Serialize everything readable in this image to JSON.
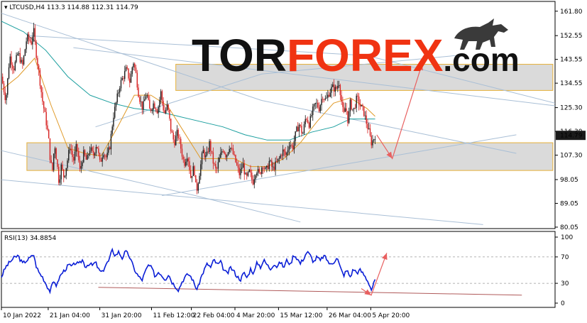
{
  "chart_data": [
    {
      "type": "candlestick",
      "symbol": "LTCUSD",
      "timeframe": "H4",
      "ohlc": {
        "open": 113.3,
        "high": 114.88,
        "low": 112.31,
        "close": 114.79
      },
      "current_price_label": "114.79",
      "price_tick_labels": [
        "161.80",
        "152.55",
        "143.55",
        "134.55",
        "125.30",
        "116.30",
        "107.30",
        "98.05",
        "89.05",
        "80.05"
      ],
      "price_ticks": [
        161.8,
        152.55,
        143.55,
        134.55,
        125.3,
        116.3,
        107.3,
        98.05,
        89.05,
        80.05
      ],
      "ylim": [
        79.5,
        165.5
      ],
      "time_tick_labels": [
        "10 Jan 2022",
        "21 Jan 04:00",
        "31 Jan 20:00",
        "11 Feb 12:00",
        "22 Feb 04:00",
        "4 Mar 20:00",
        "15 Mar 12:00",
        "26 Mar 04:00",
        "5 Apr 20:00"
      ],
      "time_ticks_x": [
        0,
        0.0845,
        0.1777,
        0.2711,
        0.3431,
        0.4218,
        0.5005,
        0.5883,
        0.6671
      ],
      "close_path": [
        [
          0.0,
          137
        ],
        [
          0.008,
          128
        ],
        [
          0.015,
          145
        ],
        [
          0.022,
          140
        ],
        [
          0.03,
          146
        ],
        [
          0.038,
          141
        ],
        [
          0.046,
          152
        ],
        [
          0.054,
          150
        ],
        [
          0.058,
          155
        ],
        [
          0.062,
          147
        ],
        [
          0.068,
          138
        ],
        [
          0.074,
          128
        ],
        [
          0.08,
          121
        ],
        [
          0.085,
          114
        ],
        [
          0.088,
          106
        ],
        [
          0.092,
          101
        ],
        [
          0.096,
          112
        ],
        [
          0.1,
          105
        ],
        [
          0.104,
          97
        ],
        [
          0.108,
          103
        ],
        [
          0.113,
          99
        ],
        [
          0.118,
          104
        ],
        [
          0.124,
          111
        ],
        [
          0.13,
          105
        ],
        [
          0.136,
          111
        ],
        [
          0.142,
          101
        ],
        [
          0.148,
          108
        ],
        [
          0.154,
          105
        ],
        [
          0.16,
          110
        ],
        [
          0.166,
          107
        ],
        [
          0.172,
          112
        ],
        [
          0.178,
          104
        ],
        [
          0.184,
          109
        ],
        [
          0.19,
          106
        ],
        [
          0.196,
          111
        ],
        [
          0.202,
          122
        ],
        [
          0.208,
          128
        ],
        [
          0.214,
          134
        ],
        [
          0.22,
          137
        ],
        [
          0.226,
          140
        ],
        [
          0.232,
          135
        ],
        [
          0.238,
          143
        ],
        [
          0.243,
          138
        ],
        [
          0.248,
          130
        ],
        [
          0.255,
          125
        ],
        [
          0.262,
          131
        ],
        [
          0.268,
          124
        ],
        [
          0.275,
          127
        ],
        [
          0.282,
          124
        ],
        [
          0.288,
          131
        ],
        [
          0.294,
          123
        ],
        [
          0.3,
          126
        ],
        [
          0.306,
          117
        ],
        [
          0.312,
          112
        ],
        [
          0.318,
          116
        ],
        [
          0.324,
          110
        ],
        [
          0.33,
          104
        ],
        [
          0.336,
          108
        ],
        [
          0.342,
          99
        ],
        [
          0.348,
          103
        ],
        [
          0.352,
          93
        ],
        [
          0.358,
          101
        ],
        [
          0.364,
          109
        ],
        [
          0.37,
          106
        ],
        [
          0.376,
          112
        ],
        [
          0.382,
          105
        ],
        [
          0.388,
          101
        ],
        [
          0.394,
          106
        ],
        [
          0.4,
          110
        ],
        [
          0.406,
          107
        ],
        [
          0.412,
          111
        ],
        [
          0.418,
          108
        ],
        [
          0.424,
          104
        ],
        [
          0.43,
          100
        ],
        [
          0.436,
          104
        ],
        [
          0.442,
          98
        ],
        [
          0.448,
          101
        ],
        [
          0.454,
          97
        ],
        [
          0.46,
          102
        ],
        [
          0.466,
          100
        ],
        [
          0.472,
          104
        ],
        [
          0.478,
          101
        ],
        [
          0.484,
          105
        ],
        [
          0.49,
          102
        ],
        [
          0.496,
          104
        ],
        [
          0.502,
          106
        ],
        [
          0.508,
          109
        ],
        [
          0.514,
          107
        ],
        [
          0.52,
          112
        ],
        [
          0.526,
          110
        ],
        [
          0.532,
          116
        ],
        [
          0.538,
          119
        ],
        [
          0.544,
          115
        ],
        [
          0.55,
          122
        ],
        [
          0.556,
          119
        ],
        [
          0.562,
          124
        ],
        [
          0.568,
          127
        ],
        [
          0.574,
          125
        ],
        [
          0.58,
          130
        ],
        [
          0.586,
          128
        ],
        [
          0.592,
          131
        ],
        [
          0.598,
          133
        ],
        [
          0.604,
          132
        ],
        [
          0.61,
          135
        ],
        [
          0.614,
          128
        ],
        [
          0.618,
          122
        ],
        [
          0.622,
          126
        ],
        [
          0.626,
          120
        ],
        [
          0.63,
          127
        ],
        [
          0.636,
          124
        ],
        [
          0.642,
          129
        ],
        [
          0.648,
          126
        ],
        [
          0.654,
          124
        ],
        [
          0.66,
          119
        ],
        [
          0.664,
          116
        ],
        [
          0.668,
          112
        ],
        [
          0.672,
          113.3
        ],
        [
          0.675,
          114.79
        ]
      ],
      "ma_fast": [
        [
          0.0,
          132
        ],
        [
          0.03,
          137
        ],
        [
          0.06,
          144
        ],
        [
          0.09,
          126
        ],
        [
          0.12,
          110
        ],
        [
          0.15,
          108
        ],
        [
          0.18,
          107
        ],
        [
          0.21,
          118
        ],
        [
          0.24,
          130
        ],
        [
          0.27,
          130
        ],
        [
          0.3,
          126
        ],
        [
          0.33,
          116
        ],
        [
          0.36,
          106
        ],
        [
          0.39,
          106
        ],
        [
          0.42,
          106
        ],
        [
          0.45,
          103
        ],
        [
          0.48,
          103
        ],
        [
          0.51,
          106
        ],
        [
          0.54,
          112
        ],
        [
          0.57,
          120
        ],
        [
          0.6,
          127
        ],
        [
          0.63,
          129
        ],
        [
          0.66,
          125
        ],
        [
          0.675,
          122
        ]
      ],
      "ma_slow": [
        [
          0.0,
          158
        ],
        [
          0.04,
          154
        ],
        [
          0.08,
          147
        ],
        [
          0.12,
          137
        ],
        [
          0.16,
          130
        ],
        [
          0.2,
          127
        ],
        [
          0.24,
          125
        ],
        [
          0.28,
          124
        ],
        [
          0.32,
          122
        ],
        [
          0.36,
          120
        ],
        [
          0.4,
          118
        ],
        [
          0.44,
          115
        ],
        [
          0.48,
          113
        ],
        [
          0.52,
          113
        ],
        [
          0.56,
          116
        ],
        [
          0.6,
          118
        ],
        [
          0.63,
          121
        ],
        [
          0.66,
          121
        ],
        [
          0.675,
          121
        ]
      ],
      "trendlines": [
        [
          [
            0.0,
            161
          ],
          [
            0.47,
            128
          ],
          [
            0.93,
            108
          ]
        ],
        [
          [
            0.05,
            152.5
          ],
          [
            0.66,
            145
          ],
          [
            1.0,
            127
          ]
        ],
        [
          [
            0.13,
            148
          ],
          [
            1.0,
            126
          ]
        ],
        [
          [
            0.17,
            118
          ],
          [
            0.47,
            138
          ],
          [
            0.82,
            145
          ]
        ],
        [
          [
            0.0,
            109
          ],
          [
            0.35,
            92
          ],
          [
            0.54,
            82
          ]
        ],
        [
          [
            0.0,
            98
          ],
          [
            0.87,
            81
          ]
        ],
        [
          [
            0.29,
            92
          ],
          [
            0.93,
            115
          ]
        ]
      ],
      "zones": [
        {
          "x0": 0.315,
          "x1": 0.996,
          "y0": 131.8,
          "y1": 141.7
        },
        {
          "x0": 0.046,
          "x1": 0.996,
          "y0": 101.5,
          "y1": 112.0
        }
      ],
      "forecast_arrow": [
        [
          0.678,
          115
        ],
        [
          0.706,
          106
        ],
        [
          0.76,
          142
        ]
      ],
      "colors": {
        "bull": "#1a1a1a",
        "bear": "#d62020",
        "ma_fast": "#e09a28",
        "ma_slow": "#1a9e9e",
        "trend": "#a9bfd6",
        "zone_fill": "#d4d4d4",
        "zone_edge": "#e6b038",
        "arrow": "#e86060",
        "price_label_bg": "#1a1a1a",
        "price_label_fg": "#ffffff"
      },
      "logo": {
        "part1": "TOR",
        "part2": "FOREX",
        "part3": ".com",
        "color1": "#111111",
        "color2": "#f03312",
        "color3": "#111111"
      }
    },
    {
      "type": "line",
      "indicator_label": "RSI(13) 34.8854",
      "tick_labels": [
        "100",
        "70",
        "30",
        "0"
      ],
      "ticks": [
        100,
        70,
        30,
        0
      ],
      "ylim": [
        0,
        100
      ],
      "levels": [
        70,
        30
      ],
      "rsi_path": [
        [
          0.0,
          40
        ],
        [
          0.008,
          55
        ],
        [
          0.015,
          62
        ],
        [
          0.022,
          68
        ],
        [
          0.03,
          72
        ],
        [
          0.038,
          60
        ],
        [
          0.046,
          65
        ],
        [
          0.054,
          70
        ],
        [
          0.058,
          75
        ],
        [
          0.062,
          58
        ],
        [
          0.068,
          46
        ],
        [
          0.074,
          40
        ],
        [
          0.08,
          30
        ],
        [
          0.085,
          22
        ],
        [
          0.088,
          18
        ],
        [
          0.092,
          28
        ],
        [
          0.096,
          34
        ],
        [
          0.1,
          25
        ],
        [
          0.104,
          38
        ],
        [
          0.11,
          46
        ],
        [
          0.116,
          52
        ],
        [
          0.122,
          58
        ],
        [
          0.128,
          55
        ],
        [
          0.134,
          62
        ],
        [
          0.14,
          58
        ],
        [
          0.146,
          66
        ],
        [
          0.152,
          55
        ],
        [
          0.158,
          60
        ],
        [
          0.164,
          57
        ],
        [
          0.17,
          62
        ],
        [
          0.176,
          50
        ],
        [
          0.182,
          46
        ],
        [
          0.188,
          58
        ],
        [
          0.194,
          64
        ],
        [
          0.2,
          80
        ],
        [
          0.206,
          72
        ],
        [
          0.212,
          78
        ],
        [
          0.218,
          68
        ],
        [
          0.224,
          78
        ],
        [
          0.23,
          73
        ],
        [
          0.236,
          60
        ],
        [
          0.242,
          48
        ],
        [
          0.248,
          40
        ],
        [
          0.254,
          35
        ],
        [
          0.26,
          48
        ],
        [
          0.266,
          58
        ],
        [
          0.272,
          52
        ],
        [
          0.278,
          40
        ],
        [
          0.284,
          48
        ],
        [
          0.29,
          42
        ],
        [
          0.296,
          36
        ],
        [
          0.302,
          44
        ],
        [
          0.308,
          32
        ],
        [
          0.314,
          26
        ],
        [
          0.32,
          20
        ],
        [
          0.326,
          32
        ],
        [
          0.332,
          40
        ],
        [
          0.338,
          44
        ],
        [
          0.344,
          38
        ],
        [
          0.35,
          26
        ],
        [
          0.354,
          20
        ],
        [
          0.36,
          38
        ],
        [
          0.366,
          50
        ],
        [
          0.372,
          60
        ],
        [
          0.378,
          54
        ],
        [
          0.384,
          66
        ],
        [
          0.39,
          58
        ],
        [
          0.396,
          62
        ],
        [
          0.402,
          50
        ],
        [
          0.408,
          44
        ],
        [
          0.414,
          54
        ],
        [
          0.42,
          48
        ],
        [
          0.426,
          40
        ],
        [
          0.432,
          36
        ],
        [
          0.438,
          46
        ],
        [
          0.444,
          38
        ],
        [
          0.45,
          52
        ],
        [
          0.456,
          45
        ],
        [
          0.462,
          62
        ],
        [
          0.468,
          55
        ],
        [
          0.474,
          65
        ],
        [
          0.48,
          58
        ],
        [
          0.486,
          52
        ],
        [
          0.492,
          60
        ],
        [
          0.498,
          55
        ],
        [
          0.504,
          62
        ],
        [
          0.51,
          54
        ],
        [
          0.516,
          66
        ],
        [
          0.522,
          58
        ],
        [
          0.528,
          74
        ],
        [
          0.534,
          68
        ],
        [
          0.54,
          60
        ],
        [
          0.546,
          68
        ],
        [
          0.552,
          78
        ],
        [
          0.558,
          72
        ],
        [
          0.564,
          62
        ],
        [
          0.57,
          70
        ],
        [
          0.576,
          64
        ],
        [
          0.582,
          72
        ],
        [
          0.588,
          66
        ],
        [
          0.594,
          58
        ],
        [
          0.6,
          62
        ],
        [
          0.606,
          70
        ],
        [
          0.612,
          54
        ],
        [
          0.618,
          42
        ],
        [
          0.624,
          50
        ],
        [
          0.63,
          40
        ],
        [
          0.636,
          52
        ],
        [
          0.642,
          46
        ],
        [
          0.648,
          50
        ],
        [
          0.654,
          44
        ],
        [
          0.66,
          36
        ],
        [
          0.664,
          30
        ],
        [
          0.668,
          20
        ],
        [
          0.672,
          28
        ],
        [
          0.675,
          34.9
        ]
      ],
      "support_line": [
        [
          0.175,
          24
        ],
        [
          0.94,
          12
        ]
      ],
      "forecast_arrow": [
        [
          0.65,
          22
        ],
        [
          0.668,
          12
        ],
        [
          0.696,
          76
        ]
      ],
      "colors": {
        "rsi": "#0a1ed6",
        "support": "#b05a5a",
        "arrow": "#e86060",
        "level": "#9a9a9a"
      }
    }
  ]
}
